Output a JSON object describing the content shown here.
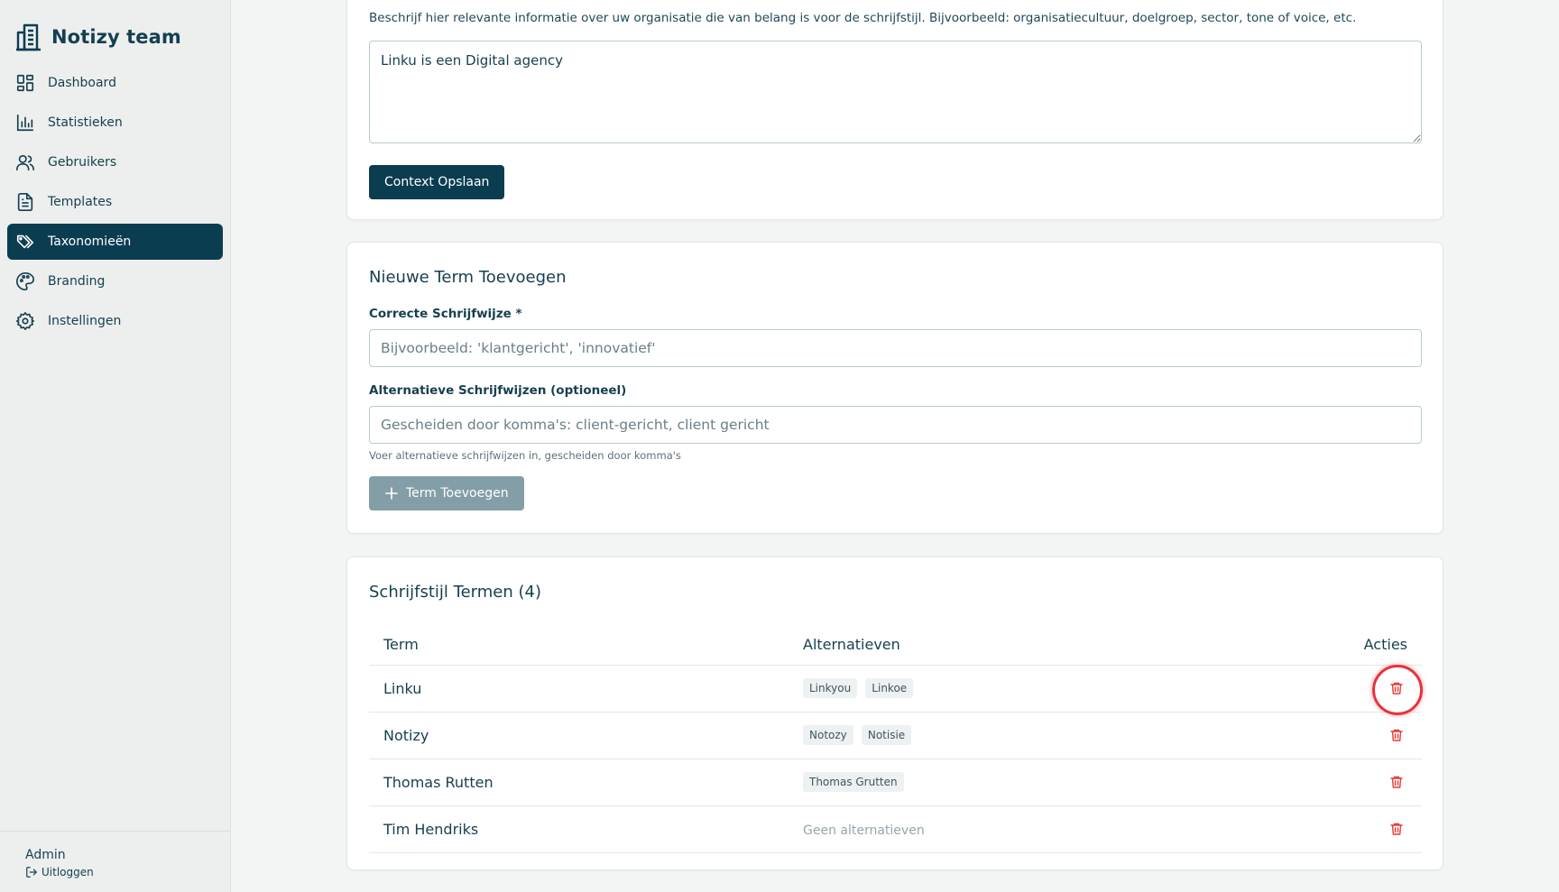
{
  "brand": {
    "title": "Notizy team"
  },
  "nav": {
    "items": [
      {
        "label": "Dashboard",
        "icon": "dashboard-icon"
      },
      {
        "label": "Statistieken",
        "icon": "bar-chart-icon"
      },
      {
        "label": "Gebruikers",
        "icon": "users-icon"
      },
      {
        "label": "Templates",
        "icon": "document-icon"
      },
      {
        "label": "Taxonomieën",
        "icon": "tags-icon",
        "active": true
      },
      {
        "label": "Branding",
        "icon": "palette-icon"
      },
      {
        "label": "Instellingen",
        "icon": "gear-icon"
      }
    ]
  },
  "footer": {
    "user": "Admin",
    "logout": "Uitloggen"
  },
  "context": {
    "help": "Beschrijf hier relevante informatie over uw organisatie die van belang is voor de schrijfstijl. Bijvoorbeeld: organisatiecultuur, doelgroep, sector, tone of voice, etc.",
    "value": "Linku is een Digital agency",
    "save_label": "Context Opslaan"
  },
  "new_term": {
    "title": "Nieuwe Term Toevoegen",
    "correct_label": "Correcte Schrijfwijze *",
    "correct_placeholder": "Bijvoorbeeld: 'klantgericht', 'innovatief'",
    "alt_label": "Alternatieve Schrijfwijzen (optioneel)",
    "alt_placeholder": "Gescheiden door komma's: client-gericht, client gericht",
    "alt_hint": "Voer alternatieve schrijfwijzen in, gescheiden door komma's",
    "add_label": "Term Toevoegen"
  },
  "terms": {
    "title": "Schrijfstijl Termen (4)",
    "columns": {
      "term": "Term",
      "alternatives": "Alternatieven",
      "actions": "Acties"
    },
    "rows": [
      {
        "term": "Linku",
        "alternatives": [
          "Linkyou",
          "Linkoe"
        ]
      },
      {
        "term": "Notizy",
        "alternatives": [
          "Notozy",
          "Notisie"
        ]
      },
      {
        "term": "Thomas Rutten",
        "alternatives": [
          "Thomas Grutten"
        ]
      },
      {
        "term": "Tim Hendriks",
        "alternatives": []
      }
    ],
    "no_alternatives": "Geen alternatieven"
  },
  "colors": {
    "primary": "#0b3d51",
    "danger": "#e53935",
    "disabled_button": "#849ea7"
  }
}
